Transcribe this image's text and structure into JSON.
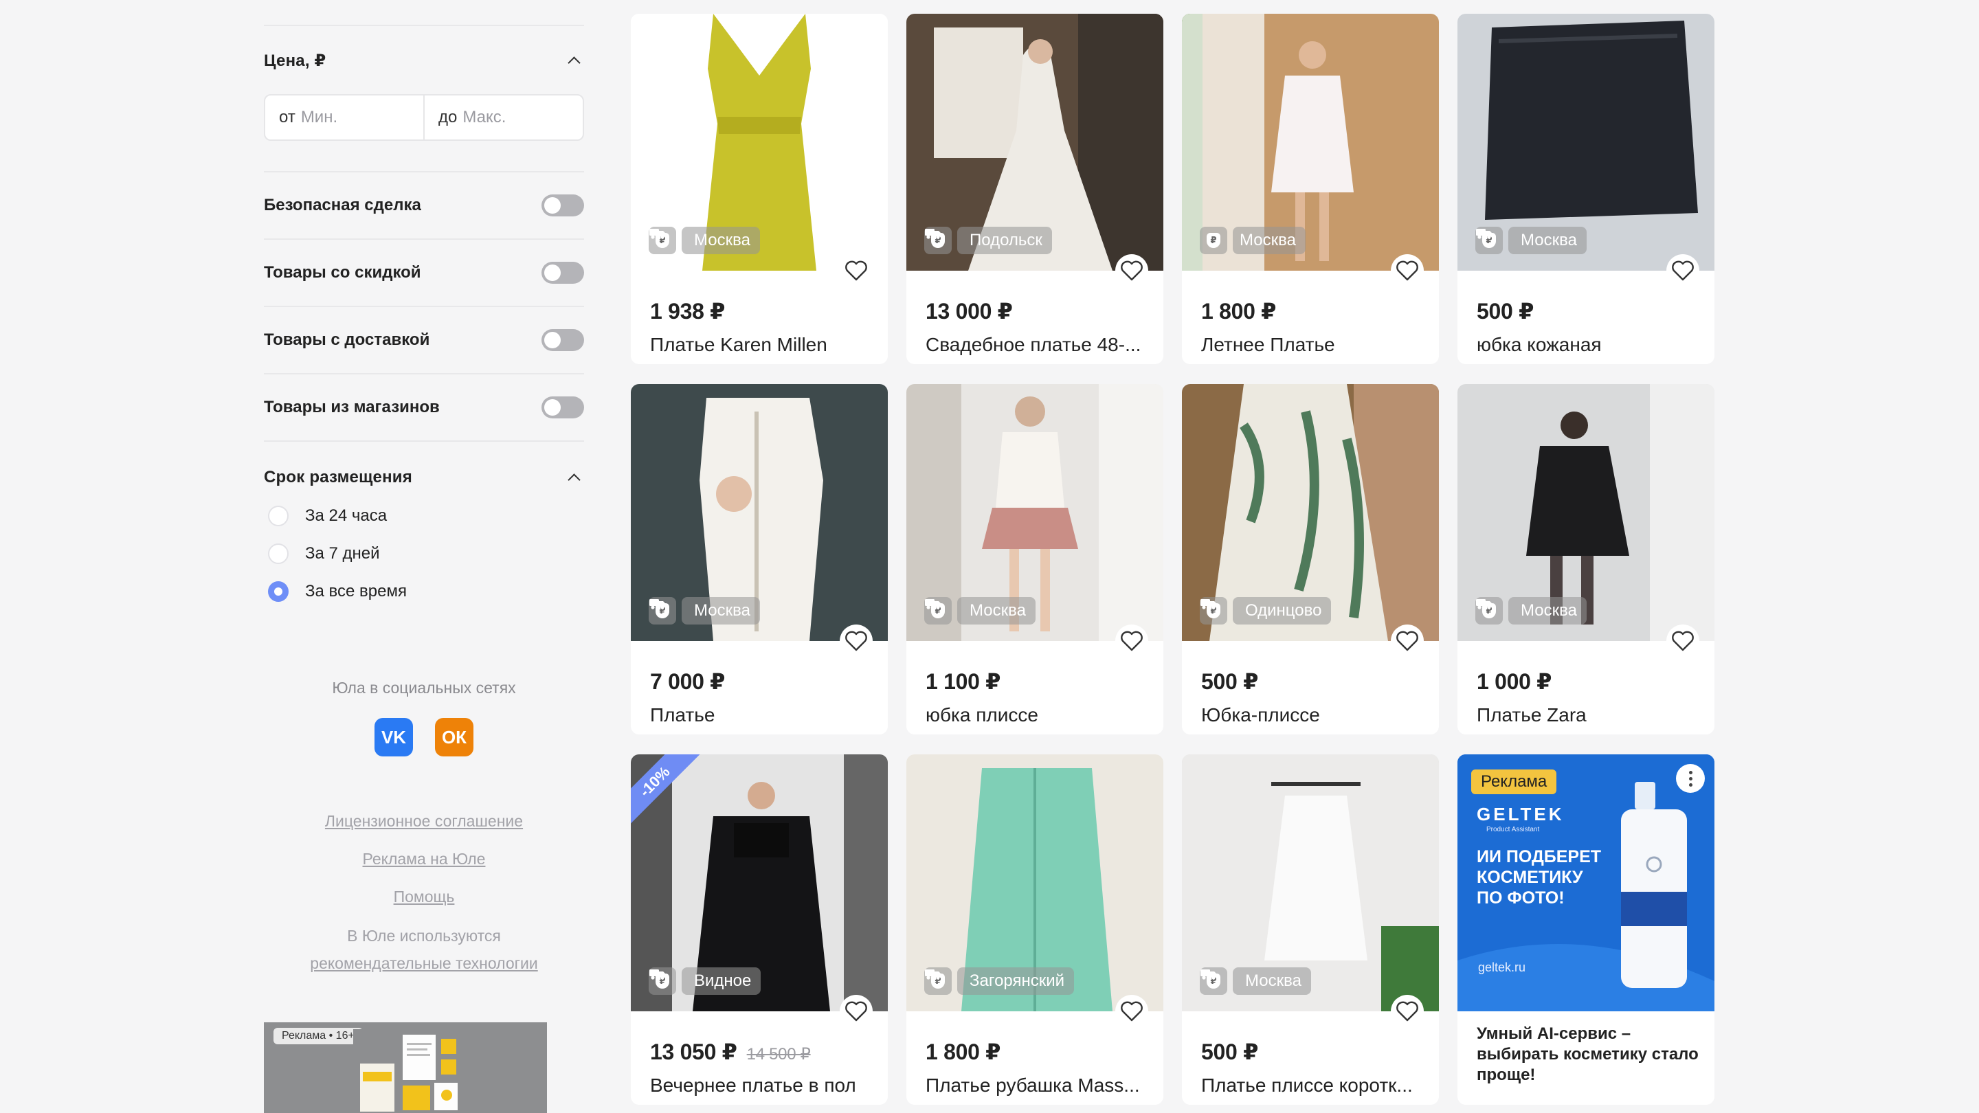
{
  "filters": {
    "price": {
      "title": "Цена, ₽",
      "from_prefix": "от",
      "from_placeholder": "Мин.",
      "to_prefix": "до",
      "to_placeholder": "Макс."
    },
    "toggles": [
      {
        "label": "Безопасная сделка",
        "on": false
      },
      {
        "label": "Товары со скидкой",
        "on": false
      },
      {
        "label": "Товары с доставкой",
        "on": false
      },
      {
        "label": "Товары из магазинов",
        "on": false
      }
    ],
    "period": {
      "title": "Срок размещения",
      "options": [
        {
          "label": "За 24 часа",
          "selected": false
        },
        {
          "label": "За 7 дней",
          "selected": false
        },
        {
          "label": "За все время",
          "selected": true
        }
      ]
    }
  },
  "social": {
    "title": "Юла в социальных сетях",
    "icons": [
      "vk-icon",
      "odnoklassniki-icon"
    ],
    "vk_glyph": "VK",
    "ok_glyph": "ОК"
  },
  "footer": {
    "license": "Лицензионное соглашение",
    "ads": "Реклама на Юле",
    "help": "Помощь",
    "rec_text": "В Юле используются",
    "rec_link": "рекомендательные технологии"
  },
  "sidebar_ad": {
    "label": "Реклама • 16+"
  },
  "products": [
    {
      "price": "1 938 ₽",
      "title": "Платье Karen Millen",
      "city": "Москва",
      "delivery": true
    },
    {
      "price": "13 000 ₽",
      "title": "Свадебное платье 48-...",
      "city": "Подольск",
      "delivery": true
    },
    {
      "price": "1 800 ₽",
      "title": "Летнее Платье",
      "city": "Москва",
      "delivery": false
    },
    {
      "price": "500 ₽",
      "title": "юбка кожаная",
      "city": "Москва",
      "delivery": true
    },
    {
      "price": "7 000 ₽",
      "title": "Платье",
      "city": "Москва",
      "delivery": true
    },
    {
      "price": "1 100 ₽",
      "title": "юбка плиссе",
      "city": "Москва",
      "delivery": true
    },
    {
      "price": "500 ₽",
      "title": "Юбка-плиссе",
      "city": "Одинцово",
      "delivery": true
    },
    {
      "price": "1 000 ₽",
      "title": "Платье Zara",
      "city": "Москва",
      "delivery": true
    },
    {
      "price": "13 050 ₽",
      "old_price": "14 500 ₽",
      "discount": "-10%",
      "title": "Вечернее платье в пол",
      "city": "Видное",
      "delivery": true
    },
    {
      "price": "1 800 ₽",
      "title": "Платье рубашка Mass...",
      "city": "Загорянский",
      "delivery": true
    },
    {
      "price": "500 ₽",
      "title": "Платье плиссе коротк...",
      "city": "Москва",
      "delivery": true
    }
  ],
  "promo": {
    "badge": "Реклама",
    "brand": "GELTEK",
    "brand_sub": "Product Assistant",
    "headline": "ИИ ПОДБЕРЕТ КОСМЕТИКУ ПО ФОТО!",
    "domain": "geltek.ru",
    "text": "Умный AI-сервис – выбирать косметику стало проще!"
  },
  "colors": {
    "accent": "#6e8ef7",
    "vk": "#2a7af3",
    "ok": "#ee8208",
    "promo_bg": "#1c6cd4",
    "promo_badge": "#f3c43f"
  }
}
